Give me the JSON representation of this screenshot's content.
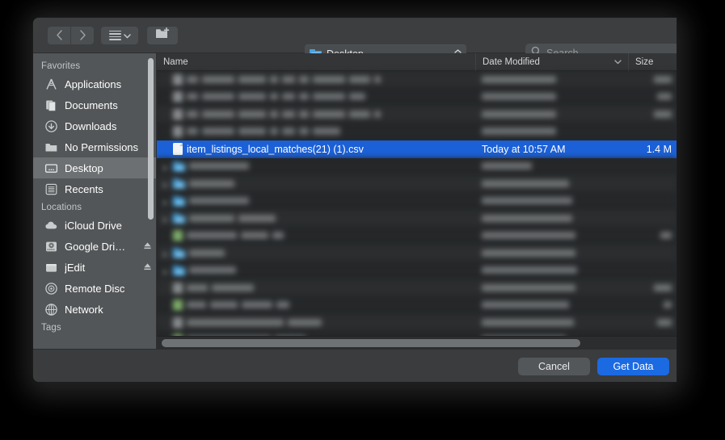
{
  "toolbar": {
    "back_icon": "chevron-left-icon",
    "forward_icon": "chevron-right-icon",
    "view_mode_icon": "list-view-icon",
    "new_folder_icon": "new-folder-icon",
    "path_label": "Desktop",
    "path_folder_icon": "folder-icon",
    "stepper_icon": "up-down-stepper-icon",
    "search_placeholder": "Search",
    "search_value": "",
    "search_icon": "search-icon"
  },
  "sidebar": {
    "sections": [
      {
        "title": "Favorites",
        "items": [
          {
            "label": "Applications",
            "icon": "applications-icon",
            "selected": false,
            "eject": false
          },
          {
            "label": "Documents",
            "icon": "documents-icon",
            "selected": false,
            "eject": false
          },
          {
            "label": "Downloads",
            "icon": "downloads-icon",
            "selected": false,
            "eject": false
          },
          {
            "label": "No Permissions",
            "icon": "folder-icon",
            "selected": false,
            "eject": false
          },
          {
            "label": "Desktop",
            "icon": "desktop-icon",
            "selected": true,
            "eject": false
          },
          {
            "label": "Recents",
            "icon": "recents-icon",
            "selected": false,
            "eject": false
          }
        ]
      },
      {
        "title": "Locations",
        "items": [
          {
            "label": "iCloud Drive",
            "icon": "cloud-icon",
            "selected": false,
            "eject": false
          },
          {
            "label": "Google Dri…",
            "icon": "hard-drive-icon",
            "selected": false,
            "eject": true
          },
          {
            "label": "jEdit",
            "icon": "disk-icon",
            "selected": false,
            "eject": true
          },
          {
            "label": "Remote Disc",
            "icon": "optical-disc-icon",
            "selected": false,
            "eject": false
          },
          {
            "label": "Network",
            "icon": "network-globe-icon",
            "selected": false,
            "eject": false
          }
        ]
      },
      {
        "title": "Tags",
        "items": []
      }
    ]
  },
  "filelist": {
    "columns": [
      {
        "key": "name",
        "label": "Name"
      },
      {
        "key": "date",
        "label": "Date Modified",
        "sort_icon": "chevron-down-icon"
      },
      {
        "key": "size",
        "label": "Size"
      }
    ],
    "rows": [
      {
        "name": "",
        "date": "",
        "size": "",
        "icon": "generic-file-icon",
        "redacted": true,
        "selected": false,
        "disclosure": false,
        "name_widths": [
          14,
          40,
          34,
          10,
          16,
          12,
          40,
          26,
          8
        ],
        "date_width": 92,
        "size_width": 22
      },
      {
        "name": "",
        "date": "",
        "size": "",
        "icon": "generic-file-icon",
        "redacted": true,
        "selected": false,
        "disclosure": false,
        "name_widths": [
          14,
          40,
          34,
          10,
          16,
          12,
          40,
          20
        ],
        "date_width": 92,
        "size_width": 18
      },
      {
        "name": "",
        "date": "",
        "size": "",
        "icon": "generic-file-icon",
        "redacted": true,
        "selected": false,
        "disclosure": false,
        "name_widths": [
          14,
          40,
          34,
          10,
          16,
          12,
          40,
          26,
          8
        ],
        "date_width": 92,
        "size_width": 22
      },
      {
        "name": "",
        "date": "",
        "size": "",
        "icon": "generic-file-icon",
        "redacted": true,
        "selected": false,
        "disclosure": false,
        "name_widths": [
          14,
          40,
          34,
          10,
          16,
          12,
          34
        ],
        "date_width": 92,
        "size_width": 0
      },
      {
        "name": "item_listings_local_matches(21) (1).csv",
        "date": "Today at 10:57 AM",
        "size": "1.4 M",
        "icon": "document-icon",
        "redacted": false,
        "selected": true,
        "disclosure": false
      },
      {
        "name": "",
        "date": "",
        "size": "",
        "icon": "folder-icon",
        "redacted": true,
        "selected": false,
        "disclosure": true,
        "name_widths": [
          74
        ],
        "date_width": 62,
        "size_width": 0
      },
      {
        "name": "",
        "date": "",
        "size": "",
        "icon": "folder-icon",
        "redacted": true,
        "selected": false,
        "disclosure": true,
        "name_widths": [
          56
        ],
        "date_width": 108,
        "size_width": 0
      },
      {
        "name": "",
        "date": "",
        "size": "",
        "icon": "folder-icon",
        "redacted": true,
        "selected": false,
        "disclosure": true,
        "name_widths": [
          74
        ],
        "date_width": 112,
        "size_width": 0
      },
      {
        "name": "",
        "date": "",
        "size": "",
        "icon": "folder-icon",
        "redacted": true,
        "selected": false,
        "disclosure": true,
        "name_widths": [
          56,
          46
        ],
        "date_width": 112,
        "size_width": 0
      },
      {
        "name": "",
        "date": "",
        "size": "",
        "icon": "sheet-icon",
        "redacted": true,
        "selected": false,
        "disclosure": false,
        "name_widths": [
          62,
          34,
          14
        ],
        "date_width": 116,
        "size_width": 14
      },
      {
        "name": "",
        "date": "",
        "size": "",
        "icon": "folder-icon",
        "redacted": true,
        "selected": false,
        "disclosure": true,
        "name_widths": [
          44
        ],
        "date_width": 116,
        "size_width": 0
      },
      {
        "name": "",
        "date": "",
        "size": "",
        "icon": "folder-icon",
        "redacted": true,
        "selected": false,
        "disclosure": true,
        "name_widths": [
          58
        ],
        "date_width": 118,
        "size_width": 0
      },
      {
        "name": "",
        "date": "",
        "size": "",
        "icon": "generic-file-icon",
        "redacted": true,
        "selected": false,
        "disclosure": false,
        "name_widths": [
          26,
          52
        ],
        "date_width": 116,
        "size_width": 22
      },
      {
        "name": "",
        "date": "",
        "size": "",
        "icon": "sheet-icon",
        "redacted": true,
        "selected": false,
        "disclosure": false,
        "name_widths": [
          24,
          34,
          38,
          16
        ],
        "date_width": 108,
        "size_width": 10
      },
      {
        "name": "",
        "date": "",
        "size": "",
        "icon": "generic-file-icon",
        "redacted": true,
        "selected": false,
        "disclosure": false,
        "name_widths": [
          120,
          42
        ],
        "date_width": 114,
        "size_width": 18
      },
      {
        "name": "",
        "date": "",
        "size": "",
        "icon": "sheet-icon",
        "redacted": true,
        "selected": false,
        "disclosure": false,
        "name_widths": [
          104,
          38
        ],
        "date_width": 104,
        "size_width": 0
      }
    ]
  },
  "footer": {
    "cancel_label": "Cancel",
    "get_data_label": "Get Data"
  }
}
